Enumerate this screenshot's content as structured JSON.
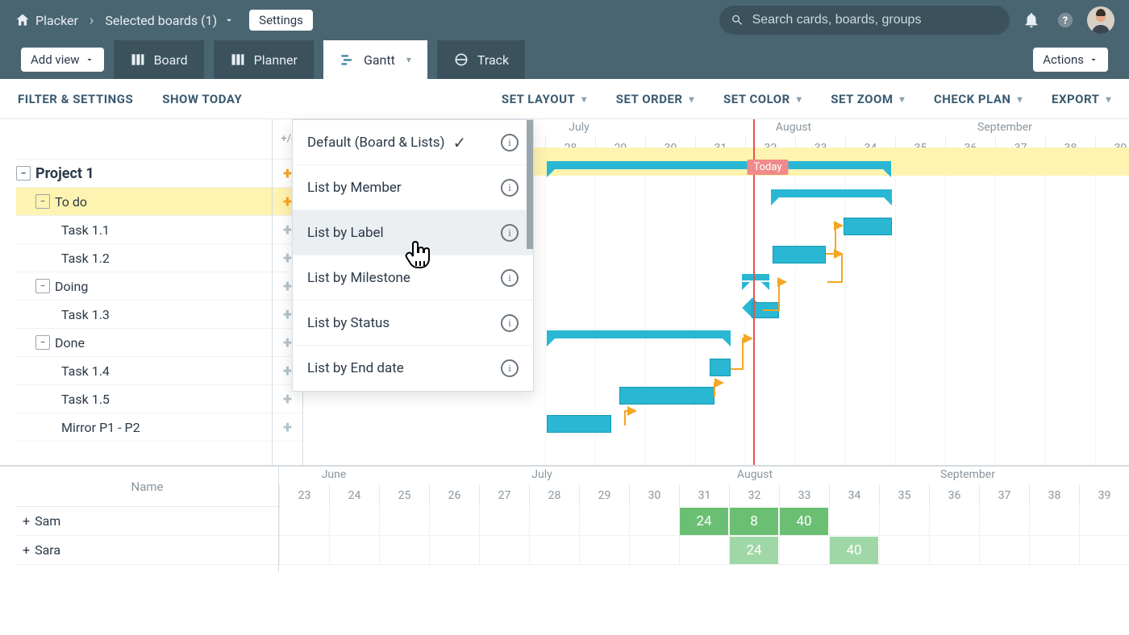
{
  "header": {
    "app_name": "Placker",
    "breadcrumb": "Selected boards (1)",
    "settings_label": "Settings",
    "search_placeholder": "Search cards, boards, groups"
  },
  "tabs": {
    "add_view": "Add view",
    "board": "Board",
    "planner": "Planner",
    "gantt": "Gantt",
    "track": "Track",
    "actions": "Actions"
  },
  "toolbar": {
    "filter": "FILTER & SETTINGS",
    "today": "SHOW TODAY",
    "layout": "SET LAYOUT",
    "order": "SET ORDER",
    "color": "SET COLOR",
    "zoom": "SET ZOOM",
    "check": "CHECK PLAN",
    "export": "EXPORT"
  },
  "layout_menu": {
    "default": "Default (Board & Lists)",
    "member": "List by Member",
    "label": "List by Label",
    "milestone": "List by Milestone",
    "status": "List by Status",
    "end_date": "List by End date"
  },
  "sidebar": {
    "plus_header": "+/-",
    "project": "Project 1",
    "todo": "To do",
    "task11": "Task 1.1",
    "task12": "Task 1.2",
    "doing": "Doing",
    "task13": "Task 1.3",
    "done": "Done",
    "task14": "Task 1.4",
    "task15": "Task 1.5",
    "mirror": "Mirror P1 - P2"
  },
  "timeline": {
    "months": {
      "july": "July",
      "august": "August",
      "september": "September"
    },
    "weeks": [
      "28",
      "29",
      "30",
      "31",
      "32",
      "33",
      "34",
      "35",
      "36",
      "37",
      "38",
      "39"
    ],
    "today": "Today"
  },
  "bottom": {
    "name_header": "Name",
    "sam": "Sam",
    "sara": "Sara",
    "months": {
      "june": "June",
      "july": "July",
      "august": "August",
      "september": "September"
    },
    "weeks": [
      "23",
      "24",
      "25",
      "26",
      "27",
      "28",
      "29",
      "30",
      "31",
      "32",
      "33",
      "34",
      "35",
      "36",
      "37",
      "38",
      "39"
    ],
    "sam_cells": {
      "v31": "24",
      "v32": "8",
      "v33": "40"
    },
    "sara_cells": {
      "v32": "24",
      "v34": "40"
    }
  }
}
